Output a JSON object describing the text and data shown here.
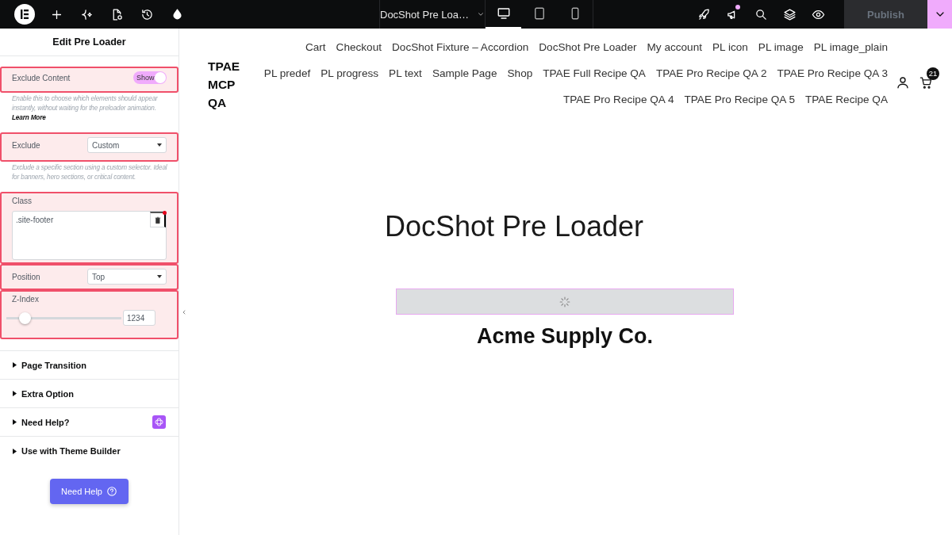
{
  "topbar": {
    "document_title": "DocShot Pre Loa…",
    "tools": [
      {
        "kind": "add"
      },
      {
        "kind": "ai"
      },
      {
        "kind": "page-settings"
      },
      {
        "kind": "history"
      },
      {
        "kind": "style"
      }
    ],
    "devices": [
      {
        "kind": "desktop",
        "selected": true
      },
      {
        "kind": "tablet",
        "selected": false
      },
      {
        "kind": "mobile",
        "selected": false
      }
    ],
    "actions": [
      {
        "kind": "launch",
        "dot": false
      },
      {
        "kind": "announce",
        "dot": true
      },
      {
        "kind": "search",
        "dot": false
      },
      {
        "kind": "layers",
        "dot": false
      },
      {
        "kind": "preview",
        "dot": false
      }
    ],
    "publish": {
      "label": "Publish",
      "disabled": true
    }
  },
  "panel": {
    "title": "Edit Pre Loader",
    "controls": [
      {
        "kind": "switch",
        "label": "Exclude Content",
        "state_label": "Show",
        "on": true,
        "highlighted": true
      },
      {
        "kind": "note",
        "text": "Enable this to choose which elements should appear instantly, without waiting for the preloader animation.",
        "link": "Learn More"
      },
      {
        "kind": "select",
        "label": "Exclude",
        "value": "Custom",
        "highlighted": true
      },
      {
        "kind": "note",
        "text": "Exclude a specific section using a custom selector. Ideal for banners, hero sections, or critical content."
      },
      {
        "kind": "textarea",
        "label": "Class",
        "value": ".site-footer",
        "highlighted": true
      },
      {
        "kind": "select",
        "label": "Position",
        "value": "Top",
        "highlighted": true
      },
      {
        "kind": "slider",
        "label": "Z-Index",
        "level": 0.12,
        "value": "1234",
        "highlighted": true
      }
    ],
    "sections": [
      {
        "label": "Page Transition",
        "expanded": false,
        "badge": false
      },
      {
        "label": "Extra Option",
        "expanded": false,
        "badge": false
      },
      {
        "label": "Need Help?",
        "expanded": false,
        "badge": true
      },
      {
        "label": "Use with Theme Builder",
        "expanded": false,
        "badge": false
      }
    ],
    "help_button": "Need Help"
  },
  "site": {
    "logo": "TPAE MCP QA",
    "nav_rows": [
      [
        "Cart",
        "Checkout",
        "DocShot Fixture – Accordion",
        "DocShot Pre Loader",
        "My account",
        "PL icon",
        "PL image",
        "PL image_plain"
      ],
      [
        "PL predef",
        "PL progress",
        "PL text",
        "Sample Page",
        "Shop",
        "TPAE Full Recipe QA",
        "TPAE Pro Recipe QA 2",
        "TPAE Pro Recipe QA 3"
      ],
      [
        "TPAE Pro Recipe QA 4",
        "TPAE Pro Recipe QA 5",
        "TPAE Recipe QA"
      ]
    ],
    "cart_count": "21",
    "page_title": "DocShot Pre Loader",
    "company": "Acme Supply Co."
  }
}
